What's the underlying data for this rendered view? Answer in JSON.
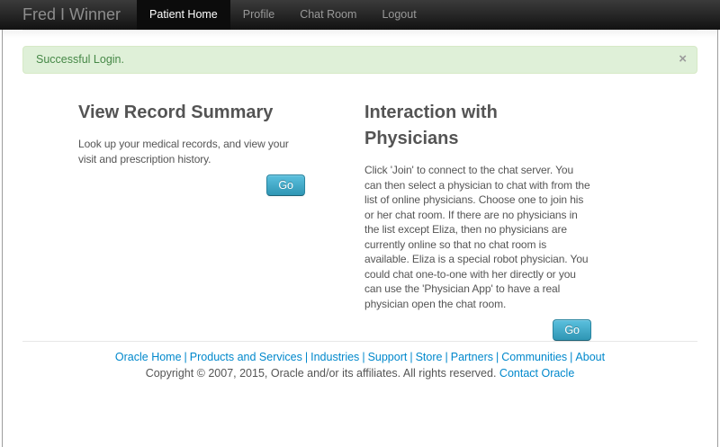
{
  "colors": {
    "navbar_top": "#3b3b3b",
    "navbar_bottom": "#121212",
    "navbar_active_bg": "#0c0c0c",
    "navbar_text": "#999999",
    "navbar_active_text": "#ffffff",
    "brand_text": "#8d8d8d",
    "alert_bg": "#dff0d8",
    "alert_border": "#d6e9c6",
    "alert_text": "#468847",
    "button_gradient_top": "#5bc0de",
    "button_gradient_bottom": "#2f96b4",
    "link": "#0088cc",
    "heading_text": "#545454",
    "body_text": "#555555"
  },
  "navbar": {
    "brand": "Fred I Winner",
    "items": [
      {
        "label": "Patient Home",
        "active": true
      },
      {
        "label": "Profile",
        "active": false
      },
      {
        "label": "Chat Room",
        "active": false
      },
      {
        "label": "Logout",
        "active": false
      }
    ]
  },
  "alert": {
    "message": "Successful Login.",
    "close": "×"
  },
  "sections": [
    {
      "title": "View Record Summary",
      "body": "Look up your medical records, and view your visit and prescription history.",
      "button": "Go"
    },
    {
      "title": "Interaction with Physicians",
      "body": "Click 'Join' to connect to the chat server. You can then select a physician to chat with from the list of online physicians. Choose one to join his or her chat room. If there are no physicians in the list except Eliza, then no physicians are currently online so that no chat room is available. Eliza is a special robot physician. You could chat one-to-one with her directly or you can use the 'Physician App' to have a real physician open the chat room.",
      "button": "Go"
    }
  ],
  "footer": {
    "links": [
      "Oracle Home",
      "Products and Services",
      "Industries",
      "Support",
      "Store",
      "Partners",
      "Communities",
      "About"
    ],
    "separator": "|",
    "copyright": "Copyright © 2007, 2015, Oracle and/or its affiliates. All rights reserved.",
    "contact": "Contact Oracle"
  }
}
